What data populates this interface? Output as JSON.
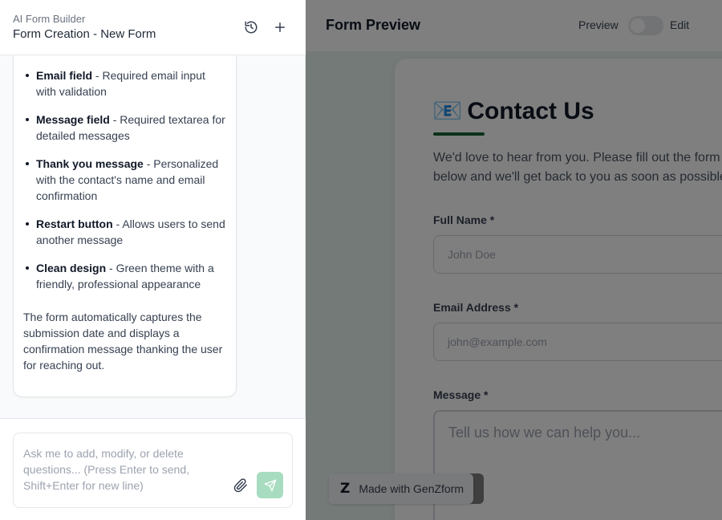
{
  "header": {
    "app_name": "AI Form Builder",
    "title": "Form Creation - New Form",
    "history_icon": "history-icon",
    "new_icon": "plus-icon"
  },
  "chat": {
    "features": [
      {
        "name": "Email field",
        "desc": " - Required email input with validation"
      },
      {
        "name": "Message field",
        "desc": " - Required textarea for detailed messages"
      },
      {
        "name": "Thank you message",
        "desc": " - Personalized with the contact's name and email confirmation"
      },
      {
        "name": "Restart button",
        "desc": " - Allows users to send another message"
      },
      {
        "name": "Clean design",
        "desc": " - Green theme with a friendly, professional appearance"
      }
    ],
    "summary": "The form automatically captures the submission date and displays a confirmation message thanking the user for reaching out."
  },
  "composer": {
    "placeholder": "Ask me to add, modify, or delete questions... (Press Enter to send, Shift+Enter for new line)",
    "attach_icon": "paperclip-icon",
    "send_icon": "send-icon"
  },
  "preview": {
    "title": "Form Preview",
    "mode_preview": "Preview",
    "mode_edit": "Edit",
    "toggle_on": false
  },
  "form": {
    "emoji": "📧",
    "title": "Contact Us",
    "description": "We'd love to hear from you. Please fill out the form below and we'll get back to you as soon as possible.",
    "fields": [
      {
        "label": "Full Name *",
        "placeholder": "John Doe"
      },
      {
        "label": "Email Address *",
        "placeholder": "john@example.com"
      },
      {
        "label": "Message *",
        "placeholder": "Tell us how we can help you..."
      }
    ],
    "accent_color": "#166534",
    "background_color": "#e8f5ee"
  },
  "badge": {
    "logo": "Z",
    "text": "Made with GenZform"
  }
}
